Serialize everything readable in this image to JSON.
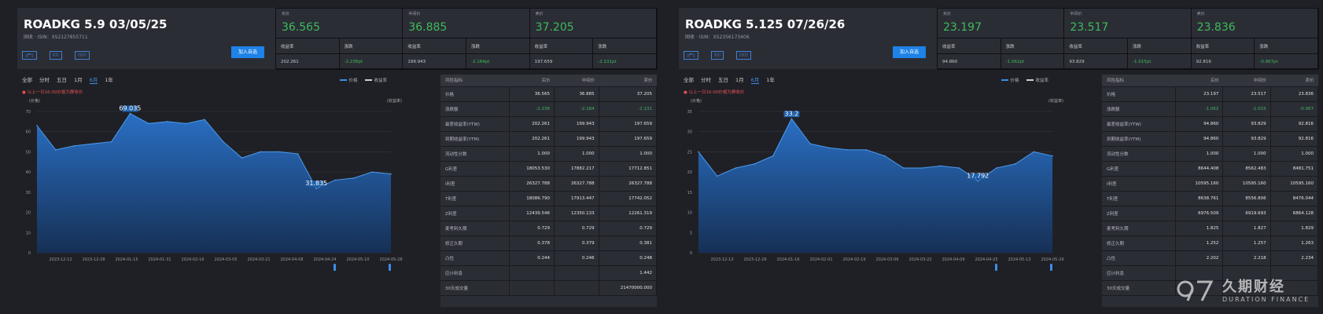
{
  "colors": {
    "accent": "#3a8ee6",
    "up": "#3dbb5b",
    "background": "#1f2026",
    "card": "#2b2d35",
    "note": "#e05050"
  },
  "common": {
    "tabs": [
      "全部",
      "分时",
      "五日",
      "1月",
      "6月",
      "1年"
    ],
    "active_tab": 4,
    "legend": [
      "价格",
      "收益率"
    ],
    "note": "以上一日16:00价格为静收价",
    "y_axis_left": "(价格)",
    "y_axis_right": "(收益率)",
    "tags": [
      "▯产▯",
      "▯▯▯",
      "▯▯▯▯"
    ],
    "add_button": "加入自选",
    "quote_labels": [
      "买价",
      "中间价",
      "卖价"
    ],
    "sub_labels": [
      "收益率",
      "涨跌"
    ],
    "table_headers": [
      "风险指标",
      "买价",
      "中间价",
      "卖价"
    ]
  },
  "bonds": [
    {
      "name": "ROADKG 5.9 03/05/25",
      "isin": "固收 · ISIN：XS2127855711",
      "bid": "36.565",
      "mid": "36.885",
      "ask": "37.205",
      "bid_yield": "202.261",
      "bid_chg": "-2.238pt",
      "mid_yield": "199.943",
      "mid_chg": "-2.184pt",
      "ask_yield": "197.659",
      "ask_chg": "-2.131pt",
      "chart_data": {
        "type": "area",
        "x": [
          "2023-12-12",
          "2023-12-28",
          "2024-01-15",
          "2024-01-31",
          "2024-02-16",
          "2024-03-05",
          "2024-03-21",
          "2024-04-08",
          "2024-04-24",
          "2024-05-10",
          "2024-05-28"
        ],
        "y_ticks": [
          0,
          10,
          20,
          30,
          40,
          50,
          60,
          70
        ],
        "ylim": [
          0,
          70
        ],
        "series": [
          {
            "name": "价格",
            "values": [
              63,
              51,
              53,
              54,
              55,
              69.035,
              64,
              65,
              64,
              66,
              55,
              47,
              50,
              50,
              49,
              31.835,
              36,
              37,
              40,
              39
            ]
          }
        ],
        "max_label": "69.035",
        "min_label": "31.835",
        "max_index": 5,
        "min_index": 15
      },
      "table": [
        [
          "价格",
          "36.565",
          "36.885",
          "37.205"
        ],
        [
          "涨跌额",
          "-2.236",
          "-2.184",
          "-2.131"
        ],
        [
          "最差收益率(YTW)",
          "202.261",
          "199.943",
          "197.659"
        ],
        [
          "到期收益率(YTM)",
          "202.261",
          "199.943",
          "197.659"
        ],
        [
          "流动性分数",
          "1.000",
          "1.000",
          "1.000"
        ],
        [
          "G利差",
          "18053.530",
          "17882.217",
          "17712.851"
        ],
        [
          "I利差",
          "26327.788",
          "26327.788",
          "26327.788"
        ],
        [
          "T利差",
          "18086.790",
          "17913.447",
          "17742.052"
        ],
        [
          "Z利差",
          "12439.546",
          "12350.133",
          "12261.319"
        ],
        [
          "麦考利久期",
          "0.729",
          "0.729",
          "0.729"
        ],
        [
          "修正久期",
          "0.378",
          "0.379",
          "0.381"
        ],
        [
          "凸性",
          "0.244",
          "0.246",
          "0.248"
        ],
        [
          "应计利息",
          "",
          "",
          "1.442"
        ],
        [
          "30天成交量",
          "",
          "",
          "21470000.000"
        ]
      ]
    },
    {
      "name": "ROADKG 5.125 07/26/26",
      "isin": "固收 · ISIN：XS2356173406",
      "bid": "23.197",
      "mid": "23.517",
      "ask": "23.836",
      "bid_yield": "94.860",
      "bid_chg": "-1.062pt",
      "mid_yield": "93.829",
      "mid_chg": "-1.015pt",
      "ask_yield": "92.816",
      "ask_chg": "-0.967pt",
      "chart_data": {
        "type": "area",
        "x": [
          "2023-12-13",
          "2023-12-29",
          "2024-01-16",
          "2024-02-01",
          "2024-02-19",
          "2024-03-06",
          "2024-03-22",
          "2024-04-09",
          "2024-04-25",
          "2024-05-13",
          "2024-05-29"
        ],
        "y_ticks": [
          0,
          5,
          10,
          15,
          20,
          25,
          30,
          35
        ],
        "ylim": [
          0,
          35
        ],
        "series": [
          {
            "name": "价格",
            "values": [
              25,
              19,
              21,
              22,
              24,
              33.2,
              27,
              26,
              25.5,
              25.5,
              24,
              21,
              21,
              21.5,
              21,
              17.792,
              21,
              22,
              25,
              24
            ]
          }
        ],
        "max_label": "33.2",
        "min_label": "17.792",
        "max_index": 5,
        "min_index": 15
      },
      "table": [
        [
          "价格",
          "23.197",
          "23.517",
          "23.836"
        ],
        [
          "涨跌额",
          "-1.062",
          "-1.015",
          "-0.967"
        ],
        [
          "最差收益率(YTW)",
          "94.860",
          "93.829",
          "92.816"
        ],
        [
          "到期收益率(YTM)",
          "94.860",
          "93.829",
          "92.816"
        ],
        [
          "流动性分数",
          "1.000",
          "1.000",
          "1.000"
        ],
        [
          "G利差",
          "8644.408",
          "8562.483",
          "8481.751"
        ],
        [
          "I利差",
          "10595.160",
          "10595.160",
          "10595.160"
        ],
        [
          "T利差",
          "8638.761",
          "8556.806",
          "8476.044"
        ],
        [
          "Z利差",
          "6976.509",
          "6919.693",
          "6864.128"
        ],
        [
          "麦考利久期",
          "1.825",
          "1.827",
          "1.829"
        ],
        [
          "修正久期",
          "1.252",
          "1.257",
          "1.263"
        ],
        [
          "凸性",
          "2.202",
          "2.218",
          "2.234"
        ],
        [
          "应计利息",
          "",
          "",
          ""
        ],
        [
          "30天成交量",
          "",
          "",
          ""
        ]
      ]
    }
  ],
  "logo": {
    "cn": "久期财经",
    "en": "DURATION FINANCE"
  }
}
